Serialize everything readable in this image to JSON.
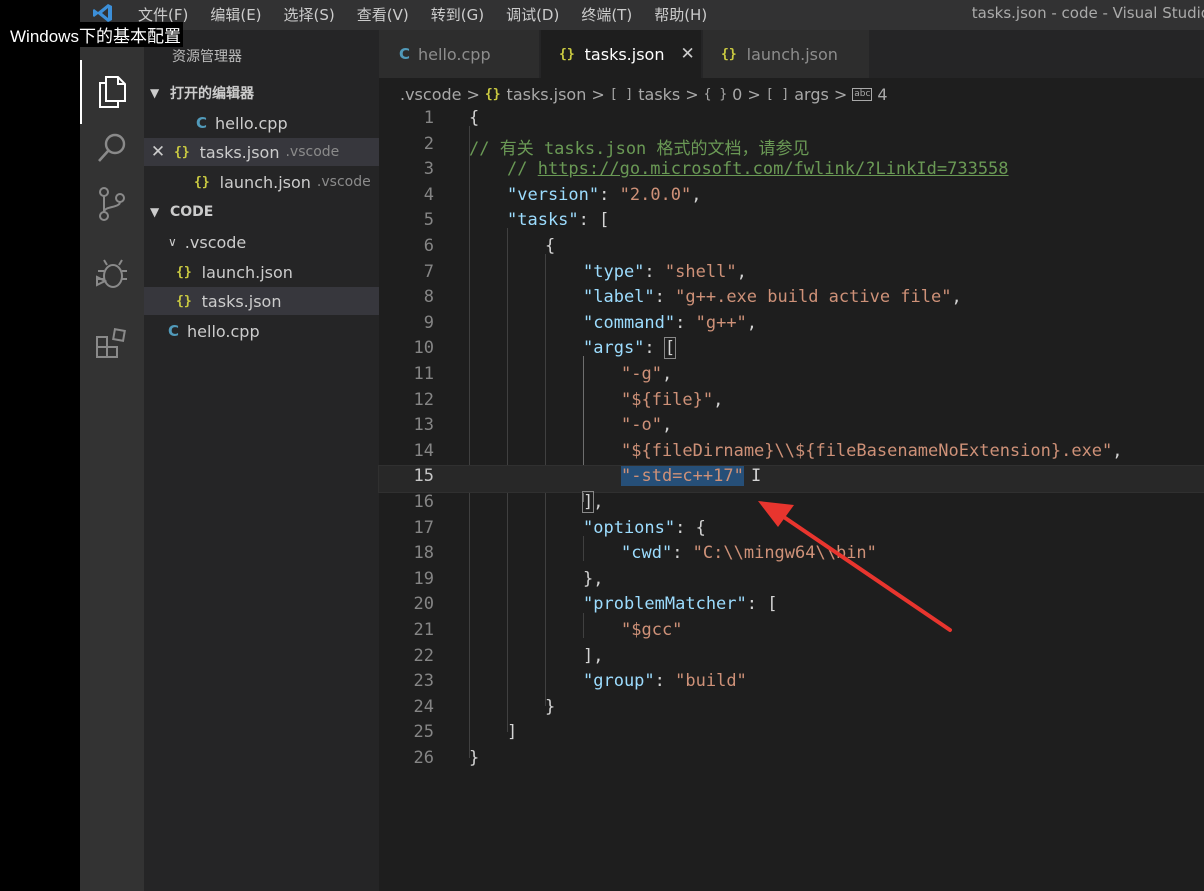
{
  "overlay_title": "Windows下的基本配置",
  "window_title": "tasks.json - code - Visual Studio",
  "menu": [
    "文件(F)",
    "编辑(E)",
    "选择(S)",
    "查看(V)",
    "转到(G)",
    "调试(D)",
    "终端(T)",
    "帮助(H)"
  ],
  "sidebar": {
    "title": "资源管理器",
    "open_editors_header": "打开的编辑器",
    "open_editors": [
      {
        "name": "hello.cpp",
        "desc": ""
      },
      {
        "name": "tasks.json",
        "desc": ".vscode"
      },
      {
        "name": "launch.json",
        "desc": ".vscode"
      }
    ],
    "folder_header": "CODE",
    "tree": [
      {
        "name": ".vscode"
      },
      {
        "name": "launch.json"
      },
      {
        "name": "tasks.json"
      },
      {
        "name": "hello.cpp"
      }
    ]
  },
  "tabs": [
    {
      "label": "hello.cpp"
    },
    {
      "label": "tasks.json"
    },
    {
      "label": "launch.json"
    }
  ],
  "breadcrumb": [
    ".vscode",
    "tasks.json",
    "tasks",
    "0",
    "args",
    "4"
  ],
  "code_lines": [
    {
      "n": "1"
    },
    {
      "n": "2"
    },
    {
      "n": "3"
    },
    {
      "n": "4"
    },
    {
      "n": "5"
    },
    {
      "n": "6"
    },
    {
      "n": "7"
    },
    {
      "n": "8"
    },
    {
      "n": "9"
    },
    {
      "n": "10"
    },
    {
      "n": "11"
    },
    {
      "n": "12"
    },
    {
      "n": "13"
    },
    {
      "n": "14"
    },
    {
      "n": "15"
    },
    {
      "n": "16"
    },
    {
      "n": "17"
    },
    {
      "n": "18"
    },
    {
      "n": "19"
    },
    {
      "n": "20"
    },
    {
      "n": "21"
    },
    {
      "n": "22"
    },
    {
      "n": "23"
    },
    {
      "n": "24"
    },
    {
      "n": "25"
    },
    {
      "n": "26"
    }
  ],
  "code": {
    "l1": "{",
    "l2": "// 有关 tasks.json 格式的文档，请参见",
    "l3a": "// ",
    "l3b": "https://go.microsoft.com/fwlink/?LinkId=733558",
    "l4k": "\"version\"",
    "l4v": "\"2.0.0\"",
    "l5k": "\"tasks\"",
    "l7k": "\"type\"",
    "l7v": "\"shell\"",
    "l8k": "\"label\"",
    "l8v": "\"g++.exe build active file\"",
    "l9k": "\"command\"",
    "l9v": "\"g++\"",
    "l10k": "\"args\"",
    "l11": "\"-g\"",
    "l12": "\"${file}\"",
    "l13": "\"-o\"",
    "l14": "\"${fileDirname}\\\\${fileBasenameNoExtension}.exe\"",
    "l15": "\"-std=c++17\"",
    "l17k": "\"options\"",
    "l18k": "\"cwd\"",
    "l18v": "\"C:\\\\mingw64\\\\bin\"",
    "l20k": "\"problemMatcher\"",
    "l21": "\"$gcc\"",
    "l23k": "\"group\"",
    "l23v": "\"build\""
  },
  "colors": {
    "accent": "#007acc",
    "annotation_arrow": "#e8352e"
  },
  "icons": [
    "explorer-icon",
    "search-icon",
    "source-control-icon",
    "debug-icon",
    "extensions-icon"
  ]
}
